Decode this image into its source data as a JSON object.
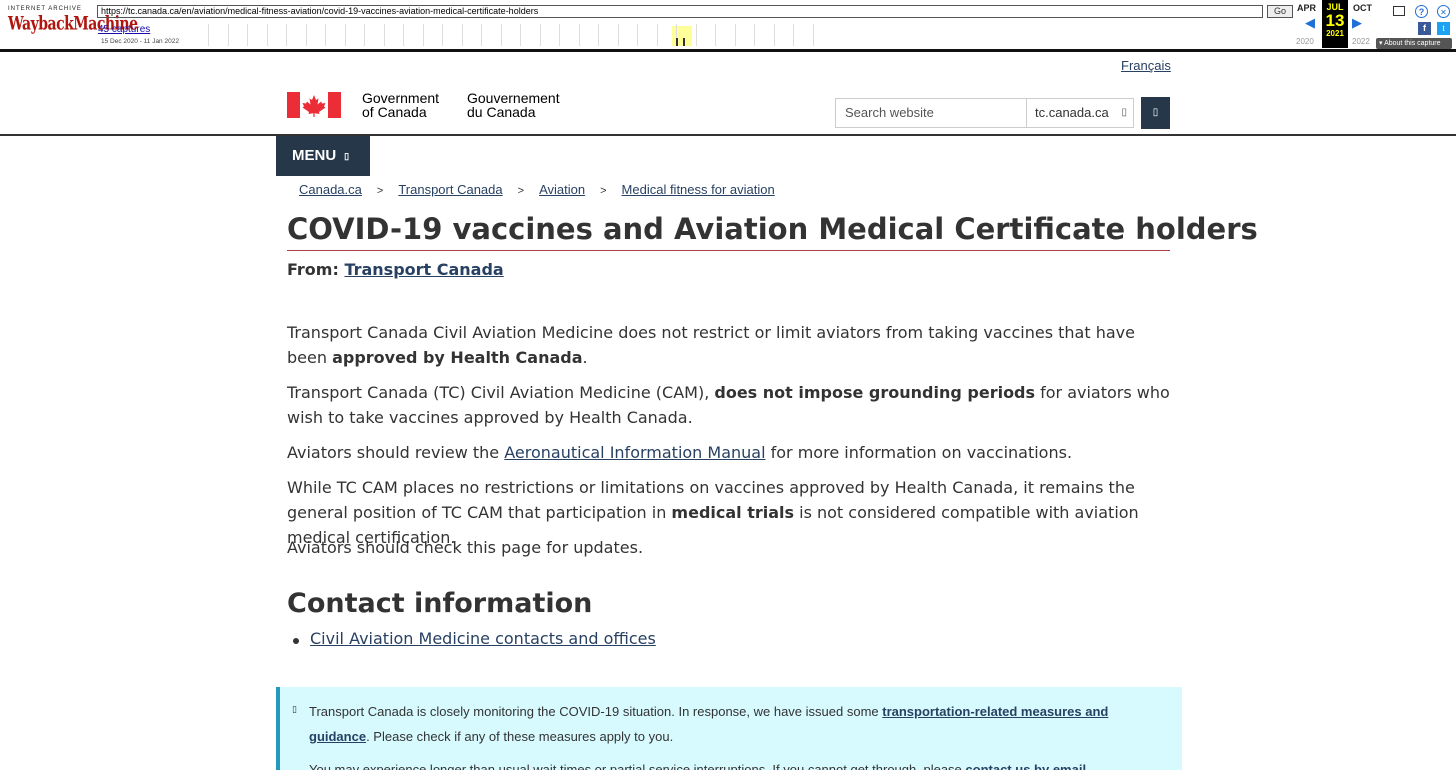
{
  "wayback": {
    "logo_top": "INTERNET ARCHIVE",
    "logo_main": "WaybackMachine",
    "url": "https://tc.canada.ca/en/aviation/medical-fitness-aviation/covid-19-vaccines-aviation-medical-certificate-holders",
    "go_label": "Go",
    "captures": "45 captures",
    "date_range": "15 Dec 2020 - 11 Jan 2022",
    "prev_month": "APR",
    "cur_month": "JUL",
    "cur_day": "13",
    "cur_year": "2021",
    "next_month": "OCT",
    "prev_year": "2020",
    "next_year": "2022",
    "about_label": "About this capture"
  },
  "header": {
    "lang_link": "Français",
    "sig_en_line1": "Government",
    "sig_en_line2": "of Canada",
    "sig_fr_line1": "Gouvernement",
    "sig_fr_line2": "du Canada",
    "search_placeholder": "Search website",
    "scope": "tc.canada.ca",
    "menu_label": "MENU"
  },
  "breadcrumb": [
    "Canada.ca",
    "Transport Canada",
    "Aviation",
    "Medical fitness for aviation"
  ],
  "content": {
    "title": "COVID-19 vaccines and Aviation Medical Certificate holders",
    "from_label": "From:",
    "from_link": "Transport Canada",
    "p1_a": "Transport Canada Civil Aviation Medicine does not restrict or limit aviators from taking vaccines that have been ",
    "p1_b": "approved by Health Canada",
    "p1_c": ".",
    "p2_a": "Transport Canada (TC) Civil Aviation Medicine (CAM), ",
    "p2_b": "does not impose grounding periods",
    "p2_c": " for aviators who wish to take vaccines approved by Health Canada.",
    "p3_a": "Aviators should review the ",
    "p3_link": "Aeronautical Information Manual",
    "p3_c": " for more information on vaccinations.",
    "p4_a": "While TC CAM places no restrictions or limitations on vaccines approved by Health Canada, it remains the general position of TC CAM that participation in ",
    "p4_b": "medical trials",
    "p4_c": " is not considered compatible with aviation medical certification.",
    "p5": "Aviators should check this page for updates.",
    "contact_heading": "Contact information",
    "contact_link": "Civil Aviation Medicine contacts and offices"
  },
  "alert": {
    "text_a": "Transport Canada is closely monitoring the COVID-19 situation. In response, we have issued some ",
    "link": "transportation-related measures and guidance",
    "text_b": ". Please check if any of these measures apply to you.",
    "text2_a": "You may experience longer than usual wait times or partial service interruptions. If you cannot get through, please ",
    "text2_link": "contact us by email"
  },
  "colors": {
    "link": "#284162",
    "nav_bg": "#26374a",
    "title_rule": "#af3c43",
    "alert_bg": "#d7faff",
    "alert_border": "#269abc",
    "flag_red": "#eb2d37"
  }
}
